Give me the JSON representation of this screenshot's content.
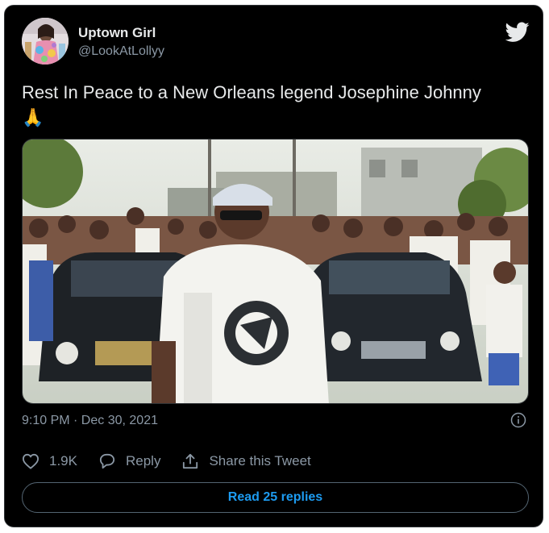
{
  "tweet": {
    "author_name": "Uptown Girl",
    "author_handle": "@LookAtLollyy",
    "text": "Rest In Peace to a New Orleans legend Josephine Johnny",
    "emoji": "🙏",
    "timestamp": "9:10 PM · Dec 30, 2021",
    "like_count": "1.9K",
    "reply_label": "Reply",
    "share_label": "Share this Tweet",
    "read_replies_label": "Read 25 replies"
  },
  "icons": {
    "platform": "twitter-bird-icon",
    "like": "heart-icon",
    "reply": "speech-bubble-icon",
    "share": "share-arrow-icon",
    "info": "info-icon"
  },
  "colors": {
    "background": "#000000",
    "text": "#e7e9ea",
    "secondary": "#8b98a5",
    "accent": "#1d9bf0",
    "border": "#2f3336"
  }
}
